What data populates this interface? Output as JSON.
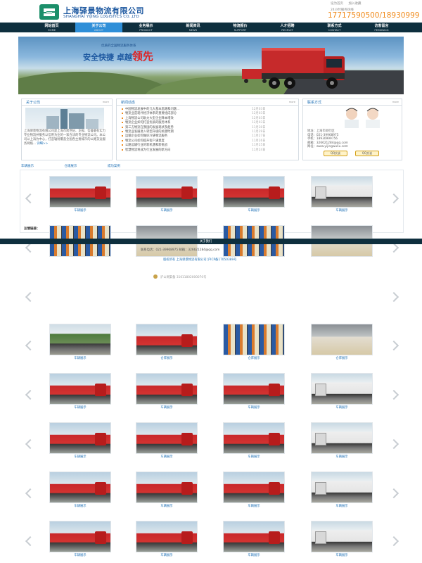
{
  "header": {
    "company_cn": "上海驿景物流有限公司",
    "company_en": "SHANGHAI YIJING LOGISTICS CO.,LTD",
    "top_links": [
      "设为首页",
      "加入收藏"
    ],
    "hotline_label": "24小时服务热线",
    "hotline": "17717590500/18930999"
  },
  "nav": [
    {
      "cn": "网站首页",
      "en": "HOME",
      "active": false
    },
    {
      "cn": "关于公司",
      "en": "ABOUT",
      "active": true
    },
    {
      "cn": "业务展示",
      "en": "PRODUCT",
      "active": false
    },
    {
      "cn": "新闻资讯",
      "en": "NEWS",
      "active": false
    },
    {
      "cn": "物流报价",
      "en": "SUPPORT",
      "active": false
    },
    {
      "cn": "人才招聘",
      "en": "RECRUIT",
      "active": false
    },
    {
      "cn": "联系方式",
      "en": "CONTACT",
      "active": false
    },
    {
      "cn": "访客留言",
      "en": "FEEDBACK",
      "active": false
    }
  ],
  "banner": {
    "subtitle": "优质的全国物流服务体系",
    "slogan": "安全快捷 卓越",
    "slogan_big": "领先"
  },
  "about": {
    "title": "关于公司",
    "more": "more",
    "text": "上海驿景物流有限公司是上海市跨世纪、正规、信誉最有实力专业物流并服务以信用为业的一家合法的专业物流公司。本公司以上海为中心，打造辐射覆盖全国各主要城市的公路货运服务网络...",
    "more_link": "详细>>"
  },
  "news": {
    "title": "新闻动态",
    "more": "more",
    "items": [
      {
        "t": "中国物流发展中的几大基本思路和问题...",
        "d": "12月03日"
      },
      {
        "t": "物流业是现代经济体系的重要组成部分",
        "d": "12月03日"
      },
      {
        "t": "上海物流公司助力大型企业降本增效",
        "d": "12月03日"
      },
      {
        "t": "物流企业如何打造优质的服务体系",
        "d": "12月03日"
      },
      {
        "t": "第三方物流在我国的发展现状及趋势",
        "d": "11月30日"
      },
      {
        "t": "物流业发展进入转型升级的关键时期",
        "d": "11月29日"
      },
      {
        "t": "运输企业如何做好冷链物流服务",
        "d": "11月27日"
      },
      {
        "t": "物流公司如何提升客户满意度",
        "d": "11月26日"
      },
      {
        "t": "公路运输行业的新机遇和新挑战",
        "d": "11月25日"
      },
      {
        "t": "智慧物流将成为行业发展的新方向",
        "d": "11月24日"
      }
    ]
  },
  "contact": {
    "title": "联系方式",
    "more": "more",
    "lines": [
      "地址：上海市闵行区",
      "电话：021-39968975",
      "手机：18930999756",
      "邮箱：326621284@qq.com",
      "网址：www.yijingwuliu.com"
    ],
    "qq": [
      "QQ交谈",
      "QQ交谈"
    ]
  },
  "tabs": [
    "车辆展示",
    "仓储展示",
    "成功案例"
  ],
  "captions": {
    "vehicle": "车辆展示",
    "warehouse": "仓库展示"
  },
  "links_label": "友情链接：",
  "footer": {
    "overlay_title": "关于我们",
    "copyright": "版权所有 上海驿景物流有限公司  沪ICP备17050389号",
    "contact_line": "联系电话：021-39968975   邮箱：326621284@qq.com",
    "police": "沪公网安备 31011802000070号"
  }
}
